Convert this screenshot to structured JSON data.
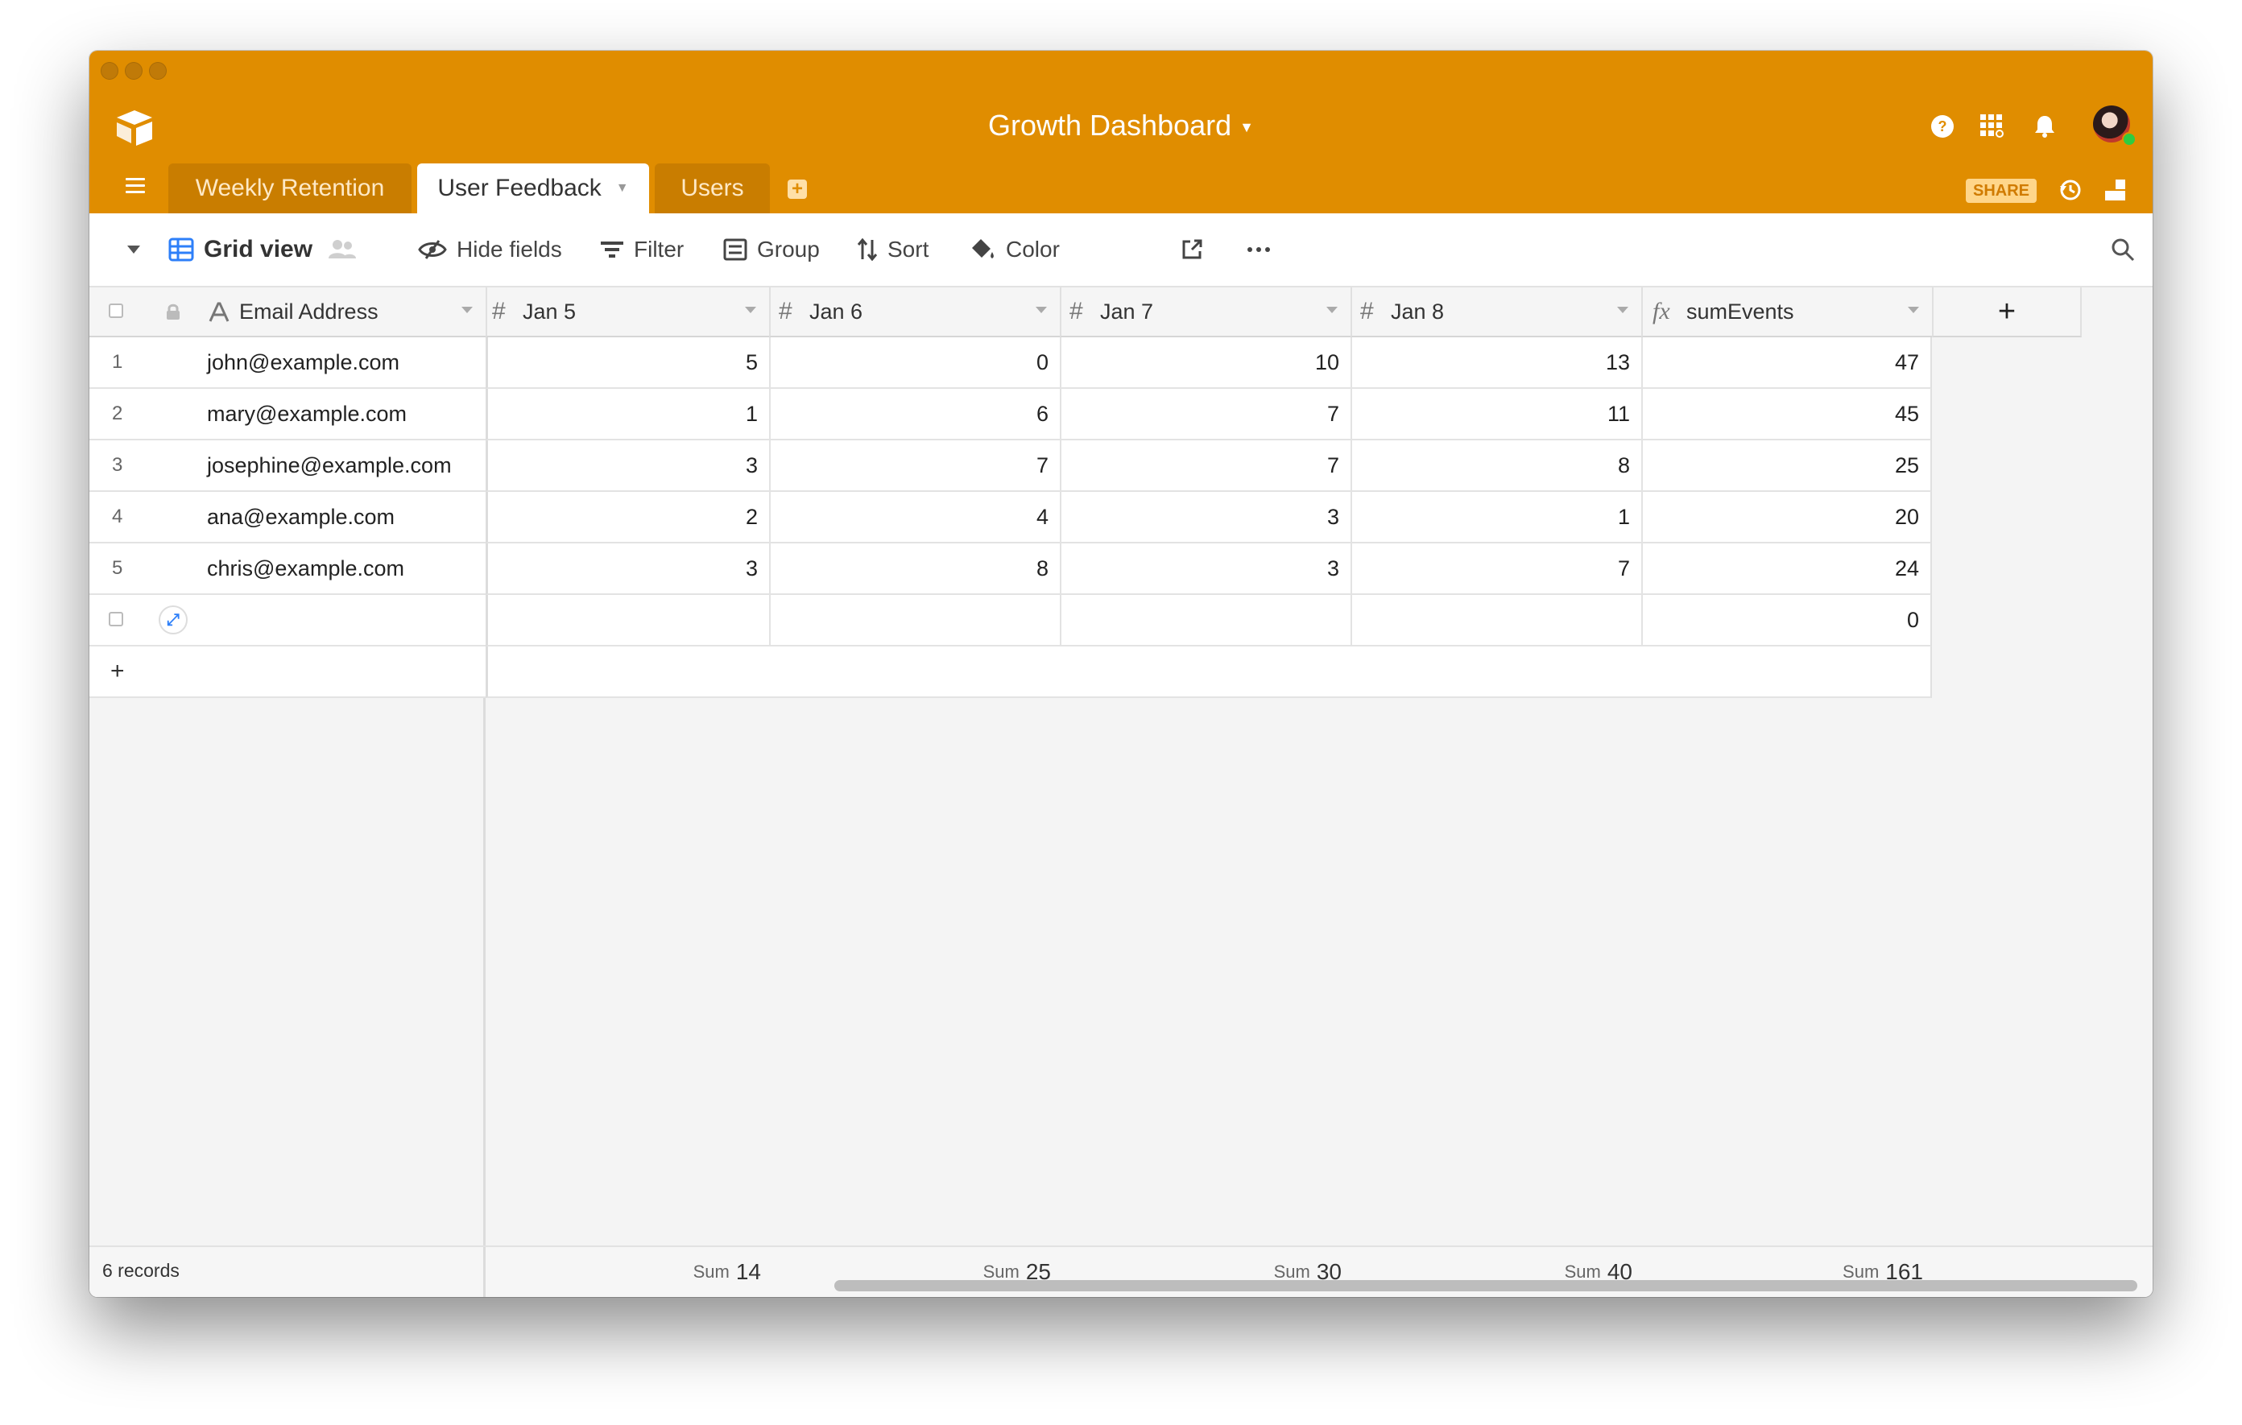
{
  "window": {
    "base_title": "Growth Dashboard",
    "tabs": [
      {
        "label": "Weekly Retention",
        "active": false
      },
      {
        "label": "User Feedback",
        "active": true
      },
      {
        "label": "Users",
        "active": false
      }
    ],
    "share_label": "SHARE",
    "accent_color": "#e08d00"
  },
  "toolbar": {
    "view_name": "Grid view",
    "hide_fields": "Hide fields",
    "filter": "Filter",
    "group": "Group",
    "sort": "Sort",
    "color": "Color"
  },
  "table": {
    "columns": [
      {
        "name": "Email Address",
        "type": "text-icon"
      },
      {
        "name": "Jan 5",
        "type": "number-icon"
      },
      {
        "name": "Jan 6",
        "type": "number-icon"
      },
      {
        "name": "Jan 7",
        "type": "number-icon"
      },
      {
        "name": "Jan 8",
        "type": "number-icon"
      },
      {
        "name": "sumEvents",
        "type": "formula-icon"
      }
    ],
    "rows": [
      {
        "num": "1",
        "email": "john@example.com",
        "jan5": "5",
        "jan6": "0",
        "jan7": "10",
        "jan8": "13",
        "sum": "47"
      },
      {
        "num": "2",
        "email": "mary@example.com",
        "jan5": "1",
        "jan6": "6",
        "jan7": "7",
        "jan8": "11",
        "sum": "45"
      },
      {
        "num": "3",
        "email": "josephine@example.com",
        "jan5": "3",
        "jan6": "7",
        "jan7": "7",
        "jan8": "8",
        "sum": "25"
      },
      {
        "num": "4",
        "email": "ana@example.com",
        "jan5": "2",
        "jan6": "4",
        "jan7": "3",
        "jan8": "1",
        "sum": "20"
      },
      {
        "num": "5",
        "email": "chris@example.com",
        "jan5": "3",
        "jan6": "8",
        "jan7": "3",
        "jan8": "7",
        "sum": "24"
      },
      {
        "num": "",
        "email": "",
        "jan5": "",
        "jan6": "",
        "jan7": "",
        "jan8": "",
        "sum": "0"
      }
    ]
  },
  "footer": {
    "record_count": "6 records",
    "sum_label": "Sum",
    "sums": [
      "14",
      "25",
      "30",
      "40",
      "161"
    ]
  }
}
